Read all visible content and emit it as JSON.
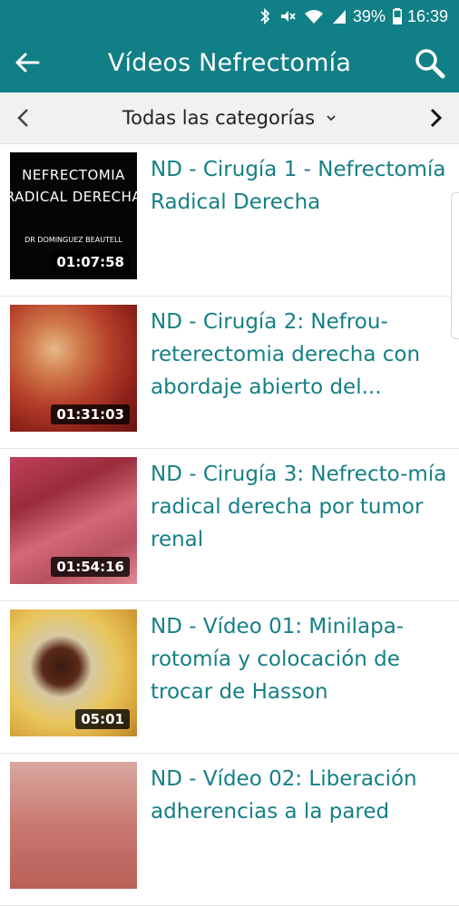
{
  "status_bar": {
    "battery_text": "39%",
    "time": "16:39",
    "icons": [
      "bluetooth-icon",
      "mute-icon",
      "wifi-icon",
      "signal-icon",
      "battery-icon"
    ]
  },
  "app_bar": {
    "title": "Vídeos Nefrectomía",
    "back_icon": "arrow-left-icon",
    "search_icon": "search-icon",
    "color": "#117f86"
  },
  "category_bar": {
    "selected": "Todas las categorías",
    "prev_icon": "chevron-left-icon",
    "next_icon": "chevron-right-icon",
    "caret_icon": "chevron-down-icon"
  },
  "videos": [
    {
      "title": "ND - Cirugía 1 - Nefrectomía Radical Derecha",
      "duration": "01:07:58",
      "thumb_text": [
        "NEFRECTOMIA",
        "RADICAL DERECHA",
        "DR DOMINGUEZ BEAUTELL"
      ]
    },
    {
      "title": "ND - Cirugía 2: Nefrou-reterectomia derecha con abordaje abierto del...",
      "duration": "01:31:03"
    },
    {
      "title": "ND - Cirugía 3: Nefrecto-mía radical derecha por tumor renal",
      "duration": "01:54:16"
    },
    {
      "title": "ND - Vídeo 01: Minilapa-rotomía y colocación de trocar de Hasson",
      "duration": "05:01"
    },
    {
      "title": "ND - Vídeo 02: Liberación adherencias a la pared",
      "duration": ""
    }
  ],
  "colors": {
    "accent": "#117f86",
    "title_text": "#157f86"
  }
}
